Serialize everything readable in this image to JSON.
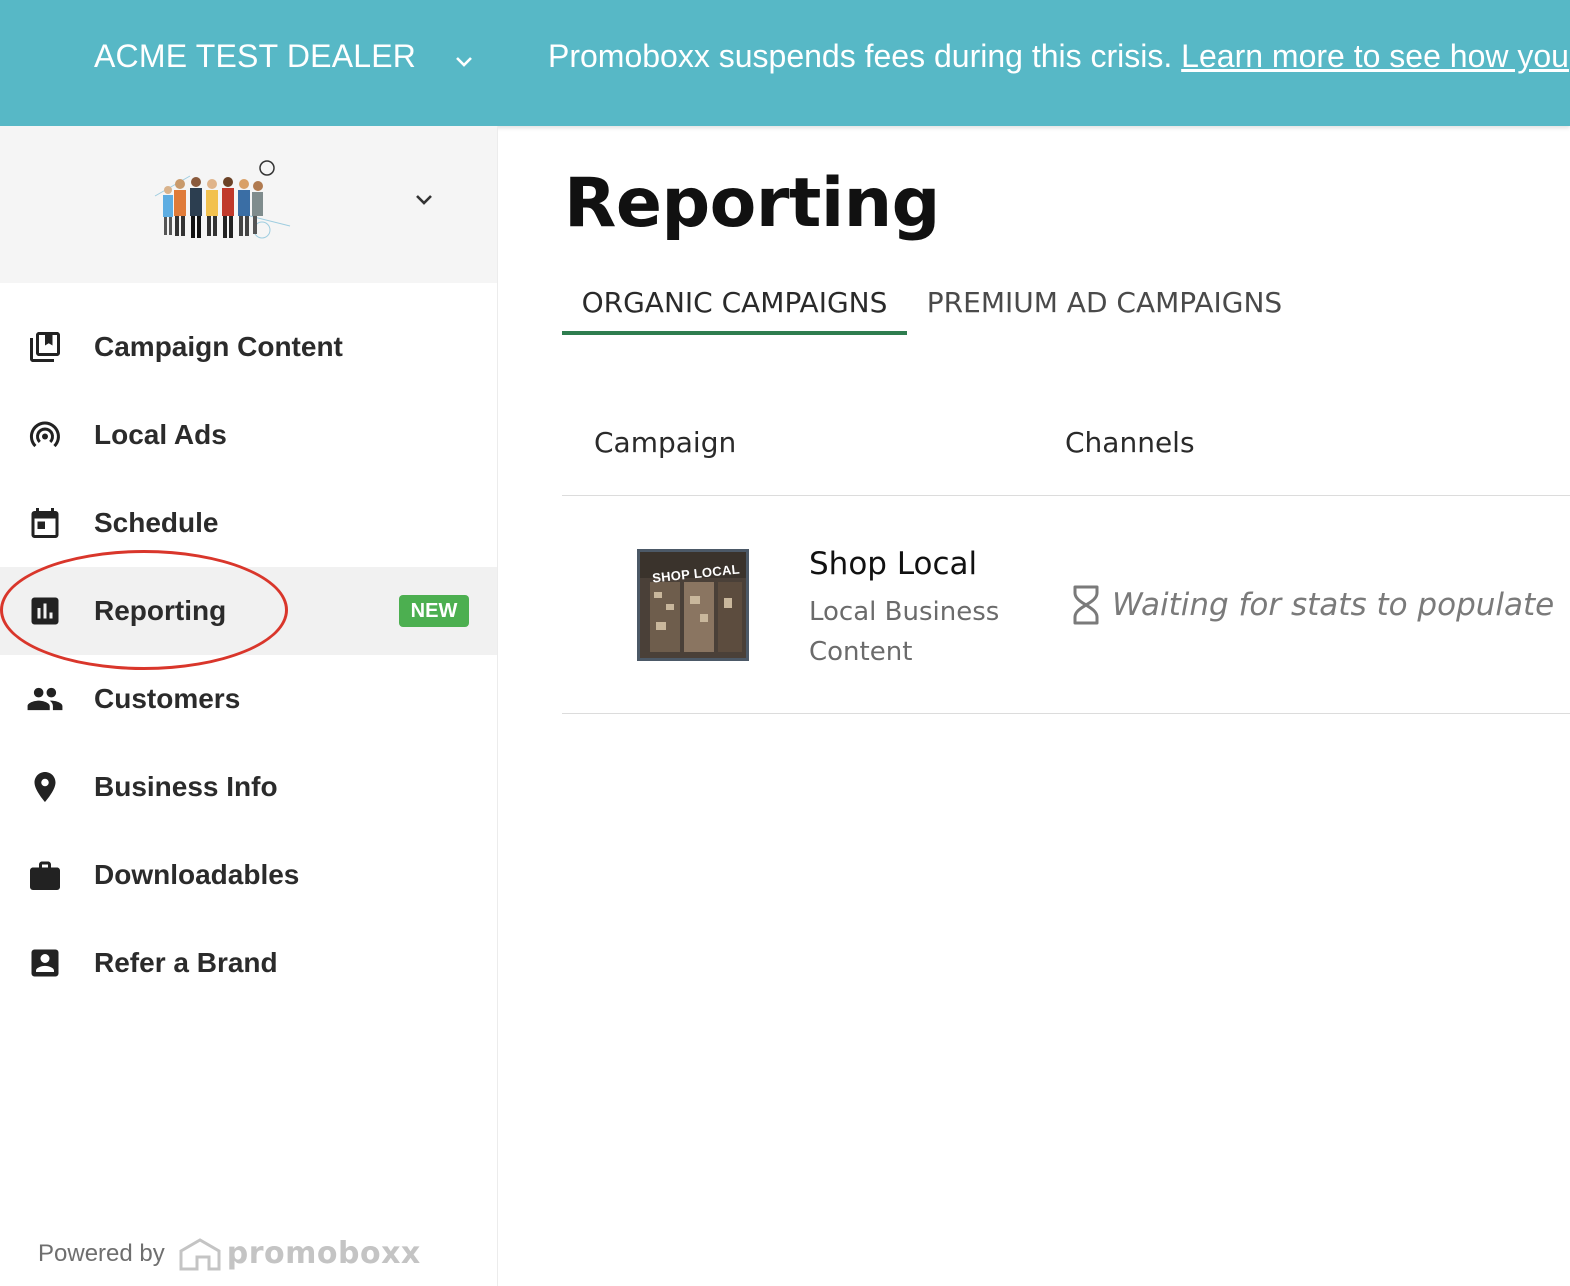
{
  "topbar": {
    "dealer_name": "ACME TEST DEALER",
    "banner_text": "Promoboxx suspends fees during this crisis. ",
    "banner_link": "Learn more to see how you"
  },
  "sidebar": {
    "items": [
      {
        "label": "Campaign Content",
        "icon": "campaign-content-icon"
      },
      {
        "label": "Local Ads",
        "icon": "local-ads-icon"
      },
      {
        "label": "Schedule",
        "icon": "calendar-icon"
      },
      {
        "label": "Reporting",
        "icon": "reporting-icon",
        "badge": "NEW",
        "active": true
      },
      {
        "label": "Customers",
        "icon": "customers-icon"
      },
      {
        "label": "Business Info",
        "icon": "location-pin-icon"
      },
      {
        "label": "Downloadables",
        "icon": "briefcase-icon"
      },
      {
        "label": "Refer a Brand",
        "icon": "contact-card-icon"
      }
    ],
    "powered_by": "Powered by",
    "powered_brand": "promoboxx"
  },
  "main": {
    "title": "Reporting",
    "tabs": [
      {
        "label": "ORGANIC CAMPAIGNS",
        "active": true
      },
      {
        "label": "PREMIUM AD CAMPAIGNS",
        "active": false
      }
    ],
    "table": {
      "headers": [
        "Campaign",
        "Channels"
      ],
      "rows": [
        {
          "thumb_text": "SHOP LOCAL",
          "title": "Shop Local",
          "subtitle": "Local Business Content",
          "status": "Waiting for stats to populate",
          "status_icon": "hourglass-icon"
        }
      ]
    }
  },
  "colors": {
    "topbar": "#57b8c6",
    "badge": "#4caf50",
    "tab_underline": "#2e7d4f",
    "highlight": "#d9362b"
  }
}
